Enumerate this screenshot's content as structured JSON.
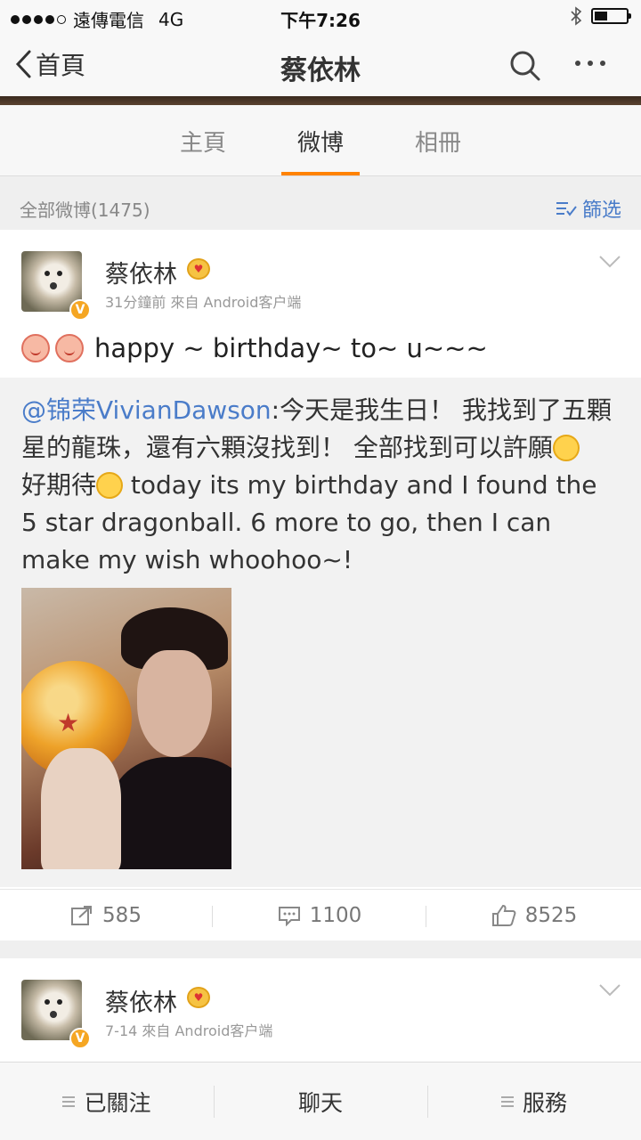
{
  "status_bar": {
    "carrier": "遠傳電信",
    "network": "4G",
    "time": "下午7:26"
  },
  "nav": {
    "back_label": "首頁",
    "title": "蔡依林"
  },
  "tabs": [
    {
      "label": "主頁",
      "active": false
    },
    {
      "label": "微博",
      "active": true
    },
    {
      "label": "相冊",
      "active": false
    }
  ],
  "filter": {
    "count_label": "全部微博(1475)",
    "filter_label": "篩选"
  },
  "posts": [
    {
      "user": "蔡依林",
      "meta": "31分鐘前  來自 Android客户端",
      "text": "happy ~ birthday~ to~ u~~~",
      "repost": {
        "mention": "@锦荣VivianDawson",
        "text_part1": ":今天是我生日！ 我找到了五顆星的龍珠，還有六顆沒找到！ 全部找到可以許願",
        "text_part2": "好期待",
        "text_part3": " today its my birthday and I found the 5 star dragonball. 6 more to go, then I can make my wish whoohoo~!"
      },
      "actions": {
        "reposts": "585",
        "comments": "1100",
        "likes": "8525"
      }
    },
    {
      "user": "蔡依林",
      "meta": "7-14  來自 Android客户端"
    }
  ],
  "bottom_bar": {
    "follow_label": "已關注",
    "chat_label": "聊天",
    "service_label": "服務"
  },
  "colors": {
    "accent": "#ff8200",
    "link": "#4a7cc9",
    "badge": "#f5a623"
  }
}
